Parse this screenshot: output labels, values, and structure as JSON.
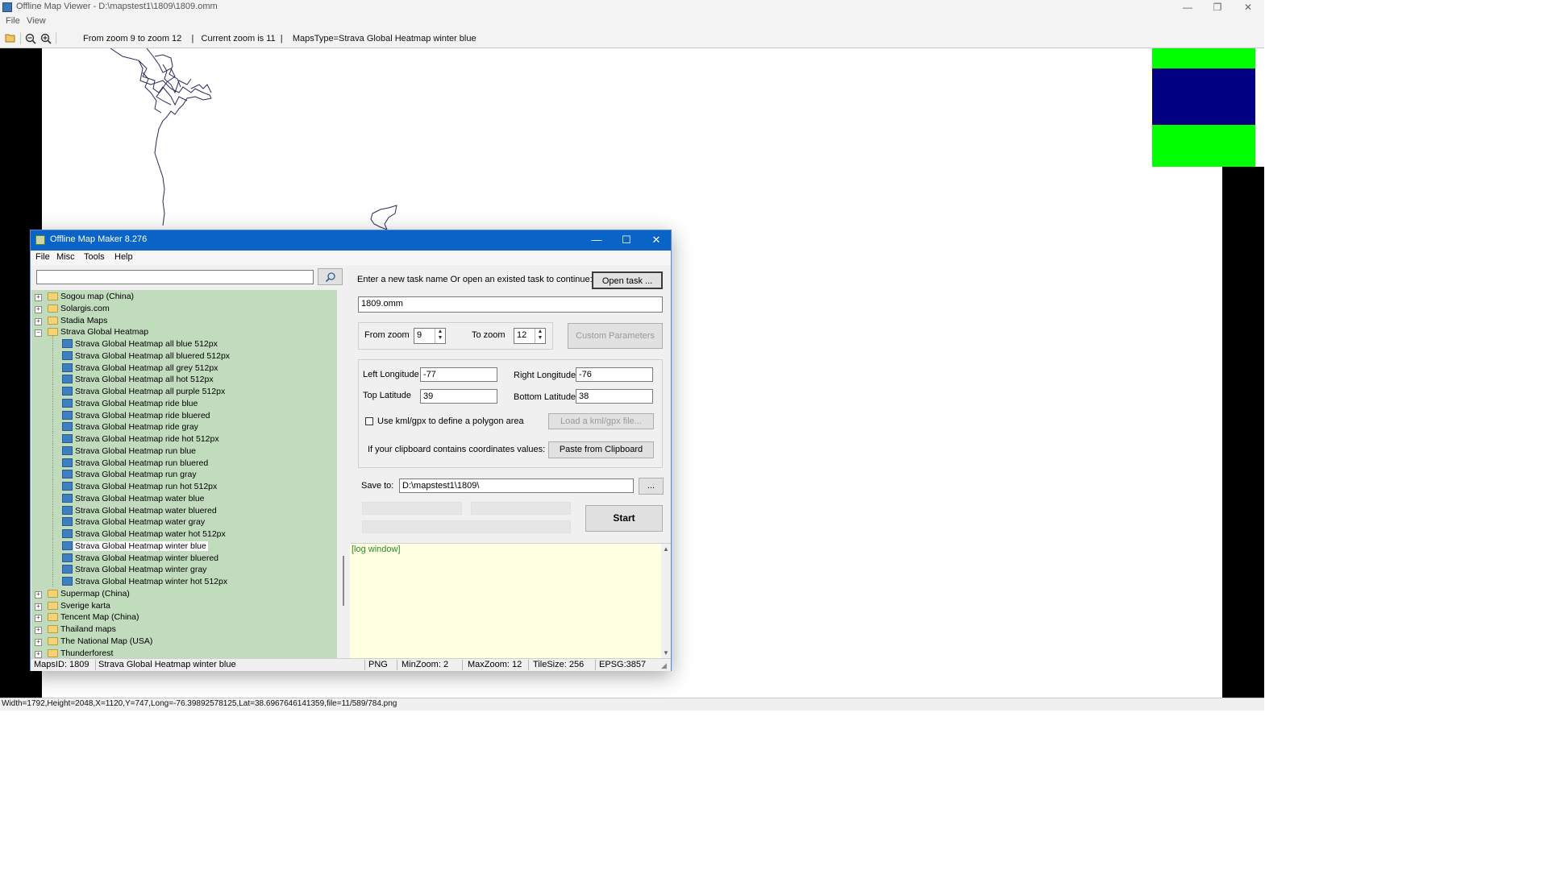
{
  "viewer": {
    "title": "Offline Map Viewer - D:\\mapstest1\\1809\\1809.omm",
    "window_controls": {
      "minimize": "—",
      "restore": "❐",
      "close": "✕"
    },
    "menu": [
      "File",
      "View"
    ],
    "toolbar": {
      "icons": [
        "open-folder-icon",
        "zoom-out-icon",
        "zoom-in-icon"
      ],
      "status": "From zoom 9 to zoom 12    |   Current zoom is 11  |    MapsType=Strava Global Heatmap winter blue"
    },
    "statusbar": "Width=1792,Height=2048,X=1120,Y=747,Long=-76.39892578125,Lat=38.6967646141359,file=11/589/784.png",
    "colors": {
      "map_black": "#000000",
      "tile_green": "#00ff00",
      "tile_navy": "#000080"
    }
  },
  "omm": {
    "title": "Offline Map Maker 8.276",
    "window_controls": {
      "minimize": "—",
      "maximize": "☐",
      "close": "✕"
    },
    "menu": [
      "File",
      "Misc",
      "Tools",
      "Help"
    ],
    "search": {
      "value": "",
      "button_icon": "search-icon"
    },
    "tree": [
      {
        "label": "Sogou map (China)",
        "type": "folder",
        "level": 0,
        "expander": "+"
      },
      {
        "label": "Solargis.com",
        "type": "folder",
        "level": 0,
        "expander": "+"
      },
      {
        "label": "Stadia Maps",
        "type": "folder",
        "level": 0,
        "expander": "+"
      },
      {
        "label": "Strava Global Heatmap",
        "type": "folder-open",
        "level": 0,
        "expander": "−"
      },
      {
        "label": "Strava Global Heatmap all blue 512px",
        "type": "map",
        "level": 1
      },
      {
        "label": "Strava Global Heatmap all bluered 512px",
        "type": "map",
        "level": 1
      },
      {
        "label": "Strava Global Heatmap all grey 512px",
        "type": "map",
        "level": 1
      },
      {
        "label": "Strava Global Heatmap all hot 512px",
        "type": "map",
        "level": 1
      },
      {
        "label": "Strava Global Heatmap all purple 512px",
        "type": "map",
        "level": 1
      },
      {
        "label": "Strava Global Heatmap ride blue",
        "type": "map",
        "level": 1
      },
      {
        "label": "Strava Global Heatmap ride bluered",
        "type": "map",
        "level": 1
      },
      {
        "label": "Strava Global Heatmap ride gray",
        "type": "map",
        "level": 1
      },
      {
        "label": "Strava Global Heatmap ride hot 512px",
        "type": "map",
        "level": 1
      },
      {
        "label": "Strava Global Heatmap run blue",
        "type": "map",
        "level": 1
      },
      {
        "label": "Strava Global Heatmap run bluered",
        "type": "map",
        "level": 1
      },
      {
        "label": "Strava Global Heatmap run gray",
        "type": "map",
        "level": 1
      },
      {
        "label": "Strava Global Heatmap run hot 512px",
        "type": "map",
        "level": 1
      },
      {
        "label": "Strava Global Heatmap water blue",
        "type": "map",
        "level": 1
      },
      {
        "label": "Strava Global Heatmap water bluered",
        "type": "map",
        "level": 1
      },
      {
        "label": "Strava Global Heatmap water gray",
        "type": "map",
        "level": 1
      },
      {
        "label": "Strava Global Heatmap water hot 512px",
        "type": "map",
        "level": 1
      },
      {
        "label": "Strava Global Heatmap winter blue",
        "type": "map",
        "level": 1,
        "selected": true
      },
      {
        "label": "Strava Global Heatmap winter bluered",
        "type": "map",
        "level": 1
      },
      {
        "label": "Strava Global Heatmap winter gray",
        "type": "map",
        "level": 1
      },
      {
        "label": "Strava Global Heatmap winter hot 512px",
        "type": "map",
        "level": 1
      },
      {
        "label": "Supermap (China)",
        "type": "folder",
        "level": 0,
        "expander": "+"
      },
      {
        "label": "Sverige karta",
        "type": "folder",
        "level": 0,
        "expander": "+"
      },
      {
        "label": "Tencent Map (China)",
        "type": "folder",
        "level": 0,
        "expander": "+"
      },
      {
        "label": "Thailand maps",
        "type": "folder",
        "level": 0,
        "expander": "+"
      },
      {
        "label": "The National Map (USA)",
        "type": "folder",
        "level": 0,
        "expander": "+"
      },
      {
        "label": "Thunderforest",
        "type": "folder",
        "level": 0,
        "expander": "+"
      }
    ],
    "task": {
      "prompt": "Enter a new task name Or open an existed task to continue:",
      "open_task_label": "Open task ...",
      "task_name": "1809.omm"
    },
    "zoom": {
      "from_label": "From zoom",
      "from_value": "9",
      "to_label": "To zoom",
      "to_value": "12",
      "custom_params_label": "Custom Parameters"
    },
    "coords": {
      "left_lon_label": "Left Longitude",
      "left_lon": "-77",
      "right_lon_label": "Right Longitude",
      "right_lon": "-76",
      "top_lat_label": "Top Latitude",
      "top_lat": "39",
      "bottom_lat_label": "Bottom Latitude",
      "bottom_lat": "38",
      "kml_checkbox_label": "Use kml/gpx to define a polygon area",
      "kml_checked": false,
      "load_kml_label": "Load a kml/gpx file...",
      "clipboard_prompt": "If your clipboard contains coordinates values:",
      "paste_label": "Paste from Clipboard"
    },
    "save": {
      "label": "Save to:",
      "path": "D:\\mapstest1\\1809\\",
      "browse_label": "...",
      "start_label": "Start"
    },
    "log": {
      "label": "[log window]"
    },
    "statusbar": {
      "maps_id": "MapsID: 1809",
      "map_name": "Strava Global Heatmap winter blue",
      "format": "PNG",
      "min_zoom": "MinZoom: 2",
      "max_zoom": "MaxZoom: 12",
      "tile_size": "TileSize: 256",
      "epsg": "EPSG:3857"
    }
  }
}
